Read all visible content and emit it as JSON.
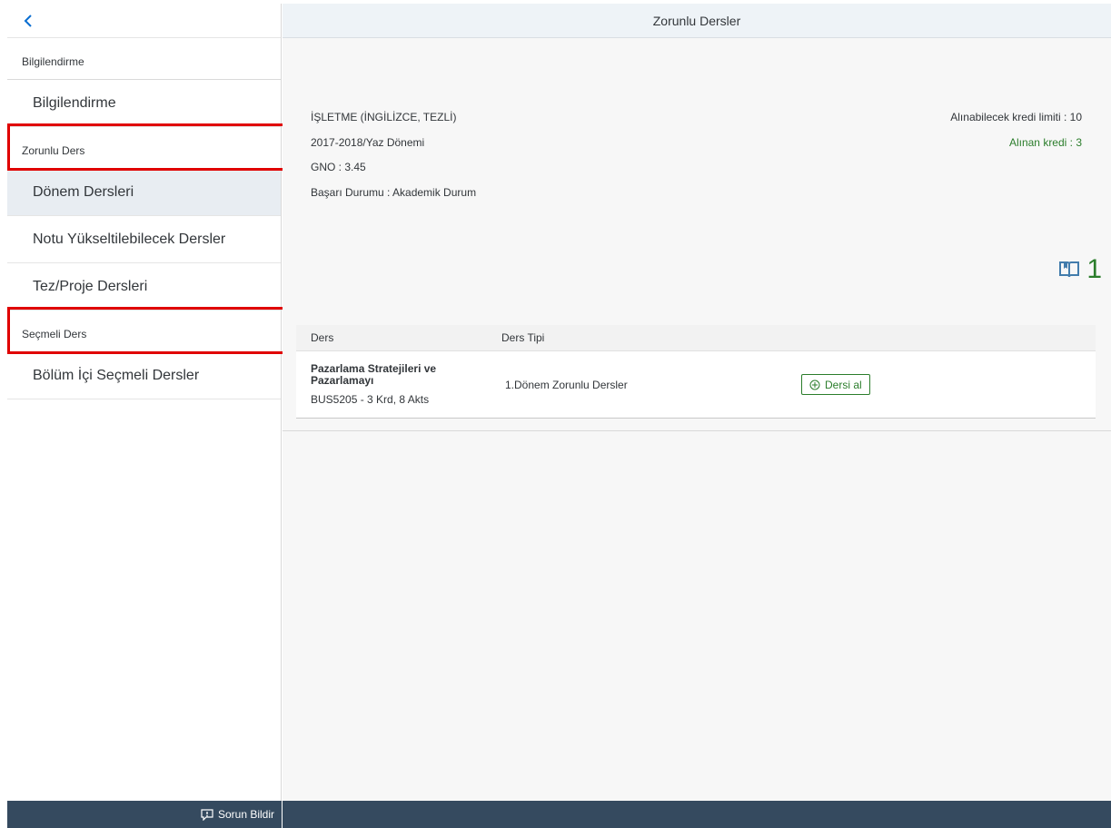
{
  "header": {
    "title": "Zorunlu Dersler"
  },
  "sidebar": {
    "groups": [
      {
        "label": "Bilgilendirme",
        "items": [
          "Bilgilendirme"
        ]
      },
      {
        "label": "Zorunlu Ders",
        "items": [
          "Dönem Dersleri",
          "Notu Yükseltilebilecek Dersler",
          "Tez/Proje Dersleri"
        ]
      },
      {
        "label": "Seçmeli Ders",
        "items": [
          "Bölüm İçi Seçmeli Dersler"
        ]
      }
    ],
    "active_item": "Dönem Dersleri"
  },
  "info": {
    "program": "İŞLETME (İNGİLİZCE, TEZLİ)",
    "term": "2017-2018/Yaz Dönemi",
    "gno": "GNO : 3.45",
    "status": "Başarı Durumu : Akademik Durum",
    "credit_limit": "Alınabilecek kredi limiti : 10",
    "credit_taken": "Alınan kredi : 3"
  },
  "counter": {
    "value": "1",
    "icon": "book-icon"
  },
  "table": {
    "headers": [
      "Ders",
      "Ders Tipi"
    ],
    "rows": [
      {
        "name": "Pazarlama Stratejileri ve Pazarlamayı",
        "code": "BUS5205 - 3 Krd, 8 Akts",
        "type": "1.Dönem Zorunlu Dersler",
        "action": "Dersi al"
      }
    ]
  },
  "footer": {
    "report_label": "Sorun Bildir"
  },
  "colors": {
    "accent_green": "#2b7d2b",
    "footer_bg": "#354a5f",
    "highlight_red": "#e00000"
  }
}
